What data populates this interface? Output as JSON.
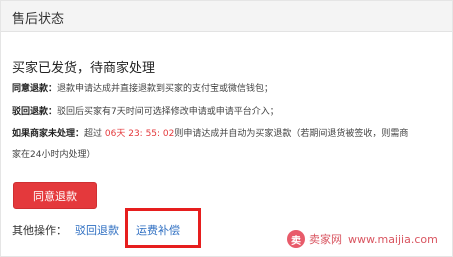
{
  "header": {
    "title": "售后状态"
  },
  "status": {
    "title": "买家已发货，待商家处理"
  },
  "info": {
    "agree_label": "同意退款：",
    "agree_text": "退款申请达成并直接退款到买家的支付宝或微信钱包；",
    "reject_label": "驳回退款：",
    "reject_text": "驳回后买家有7天时间可选择修改申请或申请平台介入；",
    "timeout_label": "如果商家未处理：",
    "timeout_prefix": "超过",
    "countdown": "06天 23: 55: 02",
    "timeout_suffix": "则申请达成并自动为买家退款（若期间退货被签收，则需商",
    "timeout_cont": "家在24小时内处理）"
  },
  "actions": {
    "agree_button": "同意退款",
    "other_label": "其他操作：",
    "reject_link": "驳回退款",
    "freight_link": "运费补偿"
  },
  "watermark": {
    "logo": "卖",
    "name": "卖家网",
    "url": "www.maijia.com"
  },
  "colors": {
    "accent": "#e4393c",
    "link": "#2f6fc2",
    "highlight": "#e61e1e"
  }
}
